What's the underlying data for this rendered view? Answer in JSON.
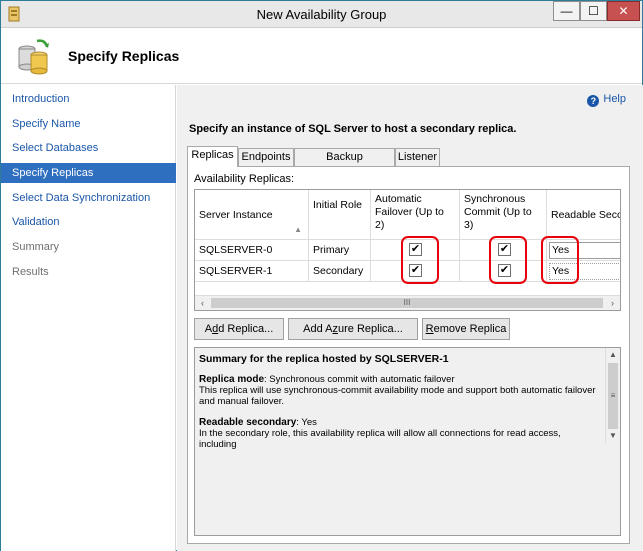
{
  "window": {
    "title": "New Availability Group",
    "close_glyph": "✕",
    "minimize_glyph": "—",
    "maximize_glyph": "☐"
  },
  "header": {
    "title": "Specify Replicas",
    "icon": "availability-group-icon"
  },
  "sidebar": {
    "items": [
      {
        "label": "Introduction",
        "state": "link"
      },
      {
        "label": "Specify Name",
        "state": "link"
      },
      {
        "label": "Select Databases",
        "state": "link"
      },
      {
        "label": "Specify Replicas",
        "state": "active"
      },
      {
        "label": "Select Data Synchronization",
        "state": "link"
      },
      {
        "label": "Validation",
        "state": "link"
      },
      {
        "label": "Summary",
        "state": "disabled"
      },
      {
        "label": "Results",
        "state": "disabled"
      }
    ]
  },
  "main": {
    "help_label": "Help",
    "instruction": "Specify an instance of SQL Server to host a secondary replica.",
    "tabs": [
      {
        "label": "Replicas",
        "active": true
      },
      {
        "label": "Endpoints",
        "active": false
      },
      {
        "label": "Backup Preferences",
        "active": false
      },
      {
        "label": "Listener",
        "active": false
      }
    ],
    "grid_label": "Availability Replicas:",
    "columns": [
      "Server Instance",
      "Initial Role",
      "Automatic Failover (Up to 2)",
      "Synchronous Commit (Up to 3)",
      "Readable Secon"
    ],
    "rows": [
      {
        "server": "SQLSERVER-0",
        "role": "Primary",
        "auto_failover": true,
        "sync_commit": true,
        "readable": "Yes"
      },
      {
        "server": "SQLSERVER-1",
        "role": "Secondary",
        "auto_failover": true,
        "sync_commit": true,
        "readable": "Yes"
      }
    ],
    "buttons": {
      "add_replica": {
        "pre": "A",
        "acc": "d",
        "post": "d Replica..."
      },
      "add_azure": {
        "pre": "Add A",
        "acc": "z",
        "post": "ure Replica..."
      },
      "remove": {
        "pre": "",
        "acc": "R",
        "post": "emove Replica"
      }
    },
    "summary": {
      "title": "Summary for the replica hosted by SQLSERVER-1",
      "replica_mode_key": "Replica mode",
      "replica_mode_value": ": Synchronous commit with automatic failover",
      "replica_mode_desc": "This replica will use synchronous-commit availability mode and support both automatic failover and manual failover.",
      "readable_key": "Readable secondary",
      "readable_value": ": Yes",
      "readable_desc": "In the secondary role, this availability replica will allow all connections for read access, including"
    },
    "highlight_color": "#e8000b"
  }
}
